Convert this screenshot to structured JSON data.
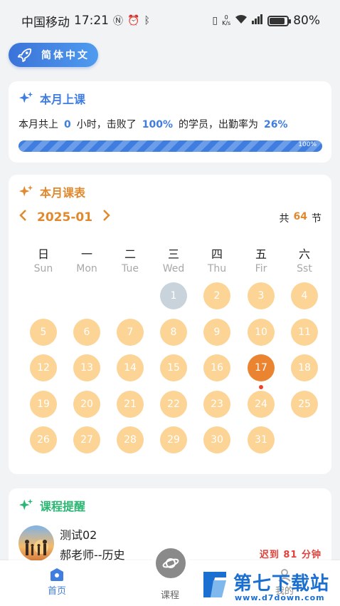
{
  "status_bar": {
    "carrier": "中国移动",
    "time": "17:21",
    "net_speed_value": "0",
    "net_speed_unit": "K/s",
    "battery": "80%"
  },
  "language_button": {
    "label": "简体中文"
  },
  "attendance_card": {
    "title": "本月上课",
    "text_prefix": "本月共上",
    "hours": "0",
    "text_mid": "小时，击败了",
    "beat_percent": "100%",
    "text_mid2": "的学员，出勤率为",
    "attendance_rate": "26%",
    "progress_value": 1.0,
    "progress_label": "100%"
  },
  "schedule_card": {
    "title": "本月课表",
    "month": "2025-01",
    "prev_icon": "chevron-left",
    "next_icon": "chevron-right",
    "total_prefix": "共",
    "total_count": "64",
    "total_suffix": "节",
    "weekdays": [
      {
        "zh": "日",
        "en": "Sun"
      },
      {
        "zh": "一",
        "en": "Mon"
      },
      {
        "zh": "二",
        "en": "Tue"
      },
      {
        "zh": "三",
        "en": "Wed"
      },
      {
        "zh": "四",
        "en": "Thu"
      },
      {
        "zh": "五",
        "en": "Fir"
      },
      {
        "zh": "六",
        "en": "Sst"
      }
    ],
    "first_weekday_index": 3,
    "days": [
      "1",
      "2",
      "3",
      "4",
      "5",
      "6",
      "7",
      "8",
      "9",
      "10",
      "11",
      "12",
      "13",
      "14",
      "15",
      "16",
      "17",
      "18",
      "19",
      "20",
      "21",
      "22",
      "23",
      "24",
      "25",
      "26",
      "27",
      "28",
      "29",
      "30",
      "31"
    ],
    "past_days": [
      "1"
    ],
    "today": "17",
    "colors": {
      "scheduled": "#fcd496",
      "past": "#c9d3dc",
      "today": "#ea8431",
      "dot": "#e8452c"
    }
  },
  "reminder_card": {
    "title": "课程提醒",
    "course_name": "测试02",
    "teacher": "郝老师--历史",
    "status": "迟到 81 分钟"
  },
  "tab_bar": {
    "home": "首页",
    "course": "课程",
    "mine": "我的"
  },
  "watermark": {
    "text": "第七下载站",
    "url": "www.d7down.com"
  },
  "colors": {
    "blue": "#3f7de0",
    "orange": "#e0892e",
    "green": "#2bb673",
    "late_red": "#e0423c"
  }
}
